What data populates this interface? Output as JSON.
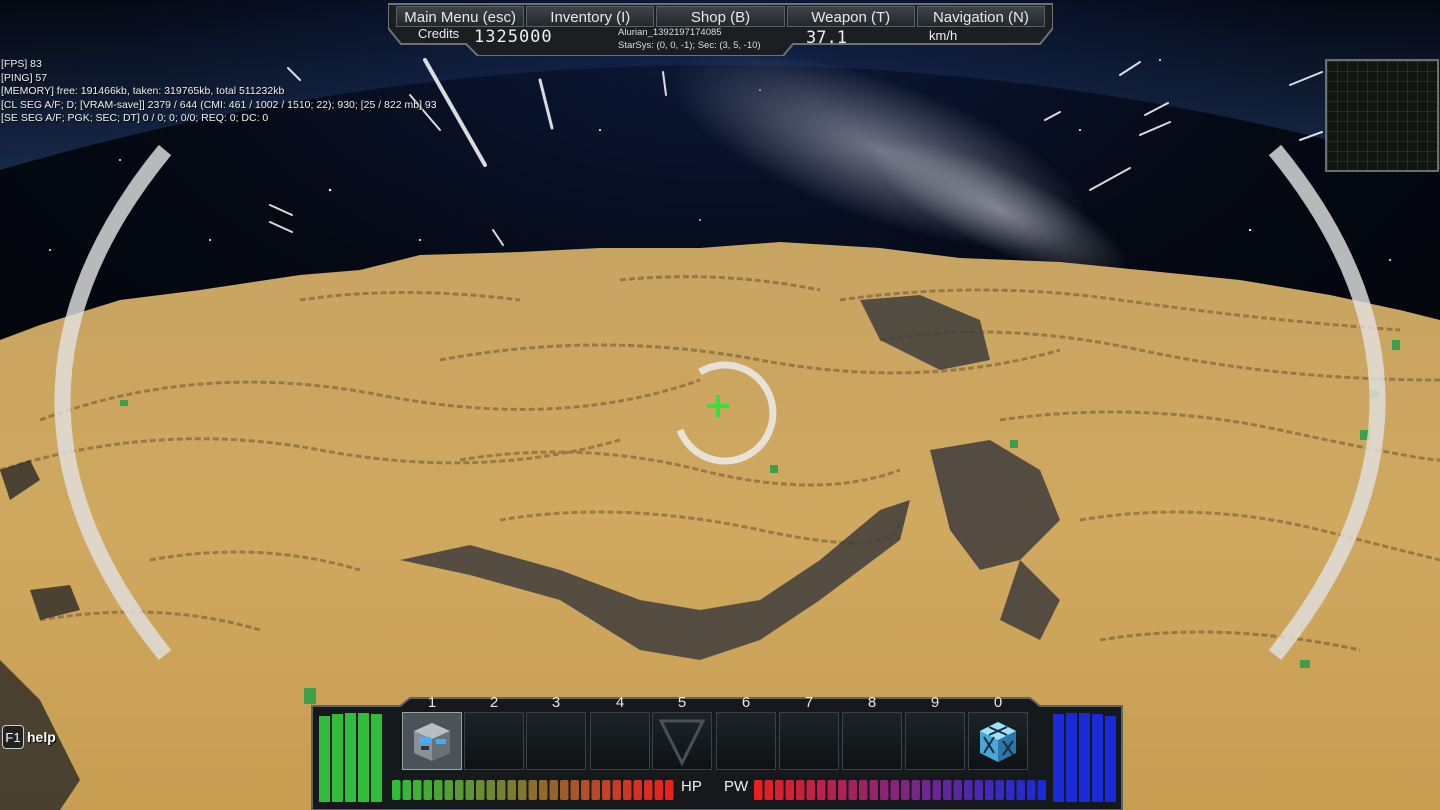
{
  "menu": {
    "items": [
      {
        "label": "Main Menu (esc)"
      },
      {
        "label": "Inventory (I)"
      },
      {
        "label": "Shop (B)"
      },
      {
        "label": "Weapon (T)"
      },
      {
        "label": "Navigation (N)"
      }
    ]
  },
  "status": {
    "credits_label": "Credits",
    "credits_value": "1325000",
    "sector_name": "Alurian_1392197174085",
    "sector_coords": "StarSys: (0, 0, -1); Sec: (3, 5, -10)",
    "speed_value": "37.1",
    "speed_unit": "km/h"
  },
  "debug": {
    "fps": "[FPS] 83",
    "ping": "[PING] 57",
    "memory": "[MEMORY] free: 191466kb, taken: 319765kb, total 511232kb",
    "cl_seg": "[CL SEG A/F; D; [VRAM-save]] 2379 / 644 (CMI: 461 / 1002 / 1510; 22); 930; [25 / 822 mb] 93",
    "se_seg": "[SE SEG A/F; PGK; SEC; DT] 0 / 0; 0; 0/0; REQ: 0; DC: 0"
  },
  "help": {
    "key": "F1",
    "label": "help"
  },
  "hotbar": {
    "slots": [
      {
        "num": "1",
        "icon": "blue-ship-block-icon"
      },
      {
        "num": "2",
        "icon": ""
      },
      {
        "num": "3",
        "icon": ""
      },
      {
        "num": "4",
        "icon": ""
      },
      {
        "num": "5",
        "icon": "triangle-marker-icon"
      },
      {
        "num": "6",
        "icon": ""
      },
      {
        "num": "7",
        "icon": ""
      },
      {
        "num": "8",
        "icon": ""
      },
      {
        "num": "9",
        "icon": ""
      },
      {
        "num": "0",
        "icon": "cyan-crystal-block-icon"
      }
    ],
    "hp_label": "HP",
    "pw_label": "PW",
    "hp_level": 1.0,
    "pw_level": 1.0,
    "shield_level": 1.0,
    "power_reserve_level": 1.0
  },
  "colors": {
    "sand": "#c9a25b",
    "crosshair": "#3ddc3d",
    "hp_green": "#2fbd3a",
    "hp_red": "#e82020",
    "pw_blue": "#1b2ad8",
    "pw_magenta": "#a0106a"
  }
}
